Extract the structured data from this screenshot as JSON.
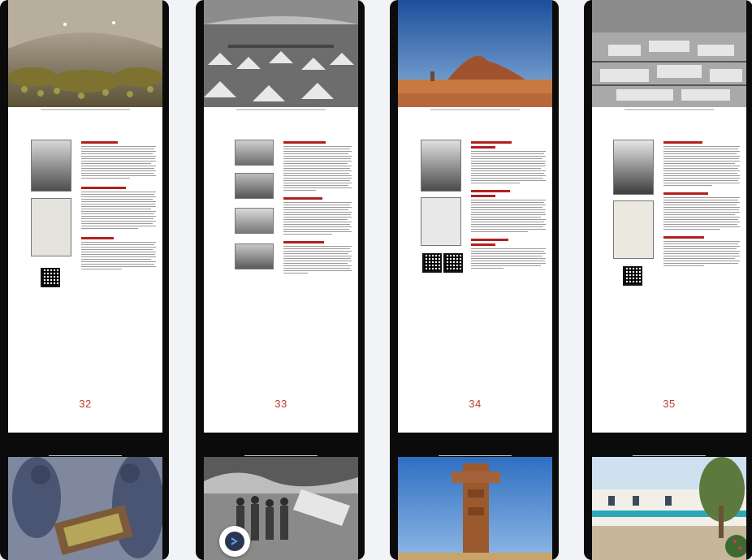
{
  "pages": [
    {
      "number": "32"
    },
    {
      "number": "33"
    },
    {
      "number": "34"
    },
    {
      "number": "35"
    }
  ],
  "icons": {
    "app_badge": "share-arrow-icon"
  },
  "colors": {
    "page_number": "#c0392b",
    "heading_red": "#b0201e"
  }
}
